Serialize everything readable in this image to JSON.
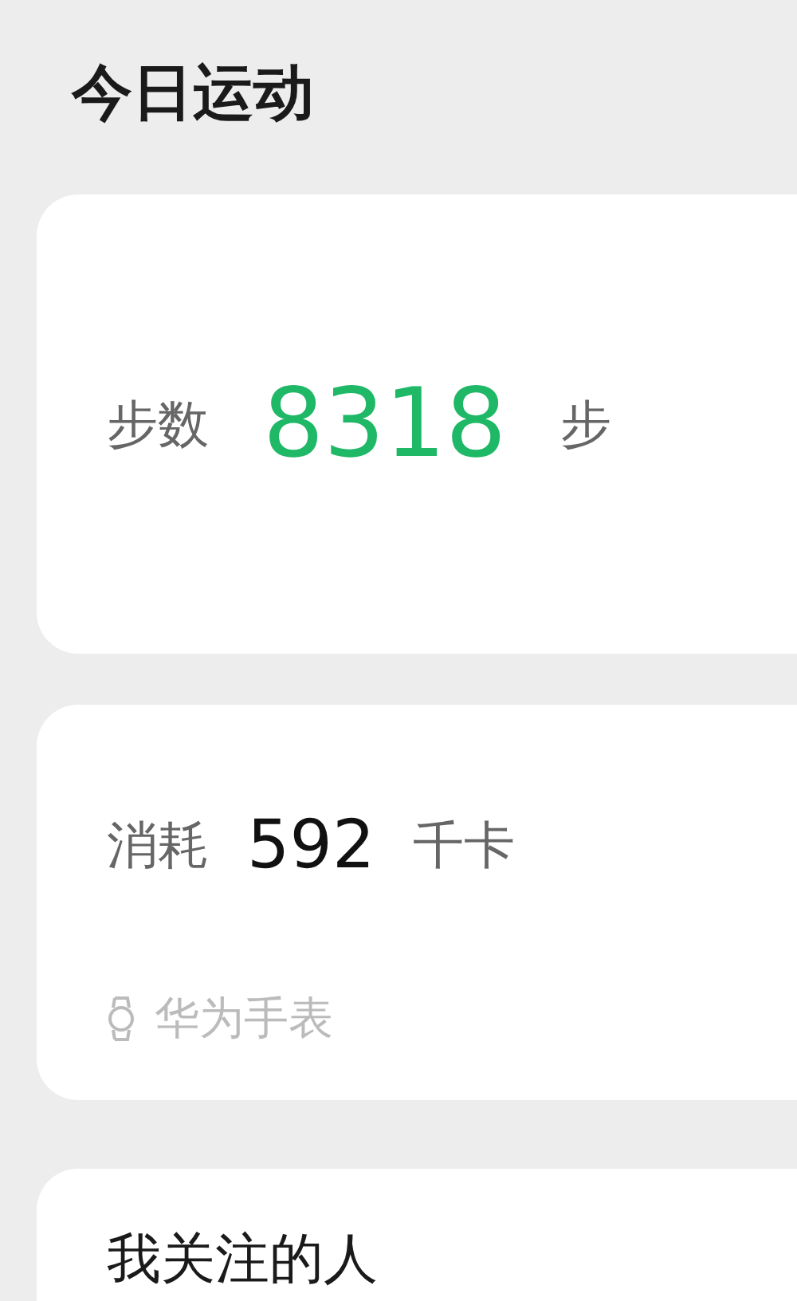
{
  "title": "今日运动",
  "steps": {
    "label": "步数",
    "value": "8318",
    "unit": "步"
  },
  "calories": {
    "label": "消耗",
    "value": "592",
    "unit": "千卡",
    "source": "华为手表"
  },
  "following": {
    "title": "我关注的人"
  }
}
